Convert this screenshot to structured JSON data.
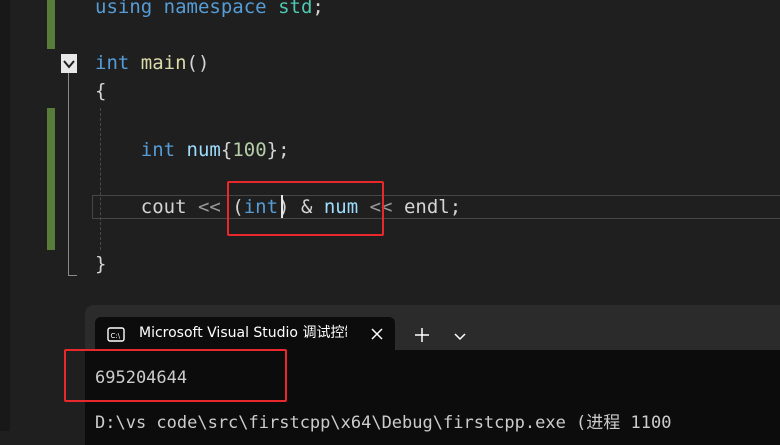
{
  "editor": {
    "code_lines": [
      {
        "tokens": [
          {
            "text": "using",
            "cls": "kw"
          },
          {
            "text": " ",
            "cls": ""
          },
          {
            "text": "namespace",
            "cls": "kw"
          },
          {
            "text": " ",
            "cls": ""
          },
          {
            "text": "std",
            "cls": "ns"
          },
          {
            "text": ";",
            "cls": ""
          }
        ]
      },
      {
        "tokens": [
          {
            "text": "int",
            "cls": "kw"
          },
          {
            "text": " ",
            "cls": ""
          },
          {
            "text": "main",
            "cls": "fn"
          },
          {
            "text": "()",
            "cls": ""
          }
        ]
      },
      {
        "tokens": [
          {
            "text": "{",
            "cls": ""
          }
        ]
      },
      {
        "tokens": [
          {
            "text": "    ",
            "cls": ""
          },
          {
            "text": "int",
            "cls": "kw"
          },
          {
            "text": " ",
            "cls": ""
          },
          {
            "text": "num",
            "cls": "var"
          },
          {
            "text": "{",
            "cls": ""
          },
          {
            "text": "100",
            "cls": "num"
          },
          {
            "text": "};",
            "cls": ""
          }
        ]
      },
      {
        "tokens": [
          {
            "text": "    cout ",
            "cls": ""
          },
          {
            "text": "<<",
            "cls": "dim"
          },
          {
            "text": " (",
            "cls": ""
          },
          {
            "text": "int",
            "cls": "kw"
          },
          {
            "text": ") & ",
            "cls": ""
          },
          {
            "text": "num",
            "cls": "var"
          },
          {
            "text": " ",
            "cls": ""
          },
          {
            "text": "<<",
            "cls": "dim"
          },
          {
            "text": " endl;",
            "cls": ""
          }
        ]
      },
      {
        "tokens": [
          {
            "text": "}",
            "cls": ""
          }
        ]
      }
    ],
    "fold_icon": "chevron-down-icon"
  },
  "console": {
    "tab_title": "Microsoft Visual Studio 调试控制台",
    "tab_icon": "terminal-icon",
    "close_icon": "close-icon",
    "new_tab_icon": "plus-icon",
    "dropdown_icon": "chevron-down-icon",
    "output_lines": [
      "695204644",
      "D:\\vs code\\src\\firstcpp\\x64\\Debug\\firstcpp.exe (进程 1100"
    ]
  },
  "colors": {
    "annotation": "#e8282b",
    "change_marker": "#587c3a",
    "editor_bg": "#1f1f1f",
    "console_bg": "#0c0c0c"
  }
}
